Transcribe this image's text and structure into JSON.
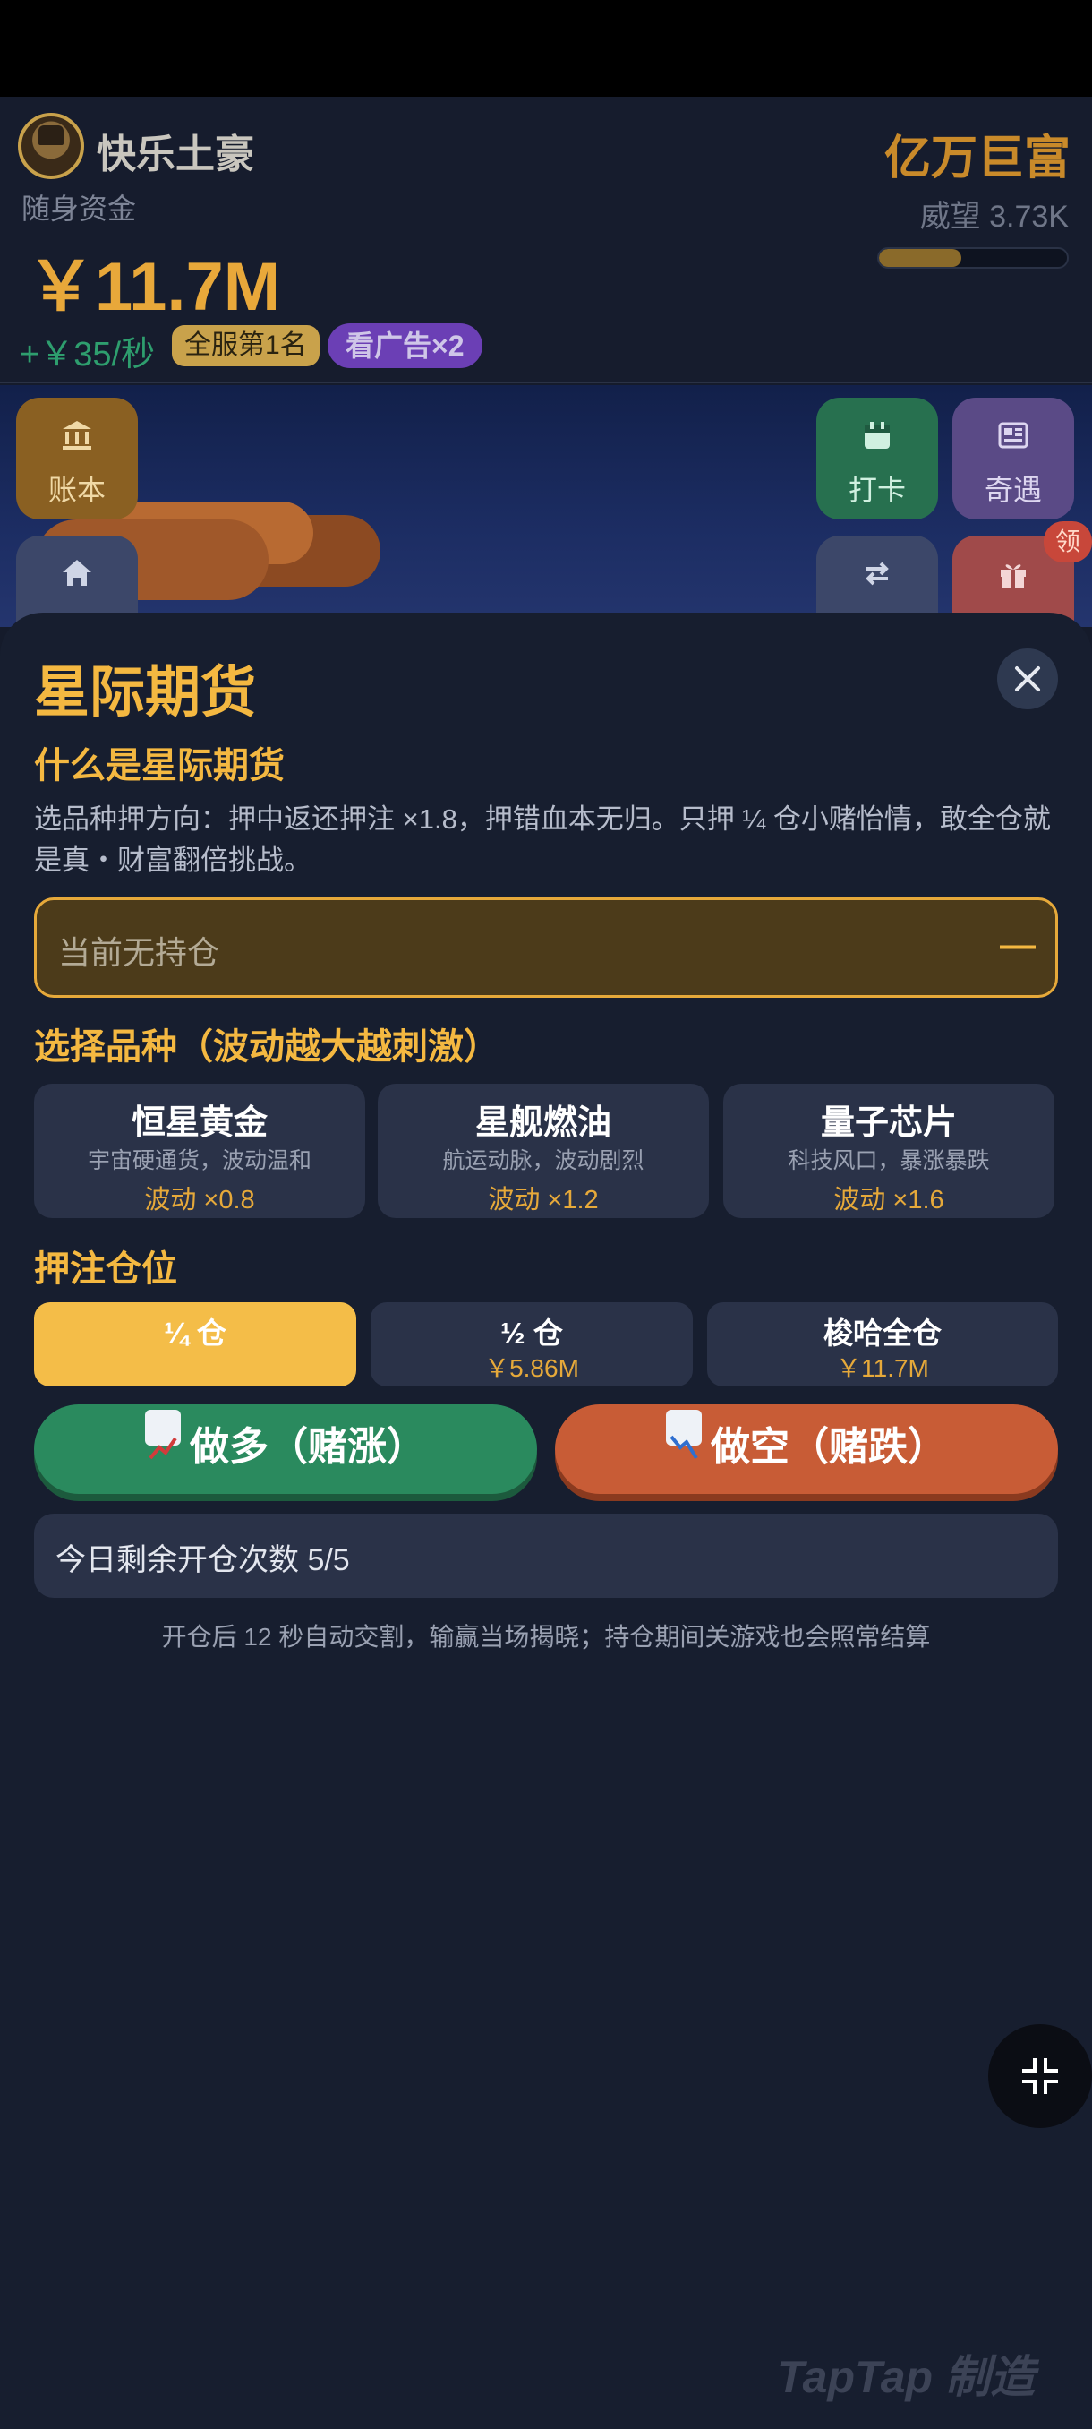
{
  "header": {
    "player_name": "快乐土豪",
    "funds_label": "随身资金",
    "funds_value": "￥11.7M",
    "income": "+￥35/秒",
    "rank_badge": "全服第1名",
    "ad_badge": "看广告×2",
    "title_rank": "亿万巨富",
    "prestige": "威望 3.73K",
    "prestige_progress": 0.44
  },
  "scene": {
    "tiles": {
      "ledger": "账本",
      "checkin": "打卡",
      "event": "奇遇"
    },
    "claim_badge": "领"
  },
  "sheet": {
    "title": "星际期货",
    "what_heading": "什么是星际期货",
    "description": "选品种押方向：押中返还押注 ×1.8，押错血本无归。只押 ¼ 仓小赌怡情，敢全仓就是真・财富翻倍挑战。",
    "position_status": "当前无持仓",
    "position_indicator": "—",
    "products_heading": "选择品种（波动越大越刺激）",
    "products": [
      {
        "name": "恒星黄金",
        "desc": "宇宙硬通货，波动温和",
        "volatility": "波动 ×0.8"
      },
      {
        "name": "星舰燃油",
        "desc": "航运动脉，波动剧烈",
        "volatility": "波动 ×1.2"
      },
      {
        "name": "量子芯片",
        "desc": "科技风口，暴涨暴跌",
        "volatility": "波动 ×1.6"
      }
    ],
    "size_heading": "押注仓位",
    "sizes": [
      {
        "name": "¼ 仓",
        "amount": "",
        "selected": true
      },
      {
        "name": "½ 仓",
        "amount": "￥5.86M",
        "selected": false
      },
      {
        "name": "梭哈全仓",
        "amount": "￥11.7M",
        "selected": false
      }
    ],
    "long_button": "做多（赌涨）",
    "short_button": "做空（赌跌）",
    "remaining": "今日剩余开仓次数 5/5",
    "footnote": "开仓后 12 秒自动交割，输赢当场揭晓；持仓期间关游戏也会照常结算"
  },
  "watermark": "TapTap 制造"
}
